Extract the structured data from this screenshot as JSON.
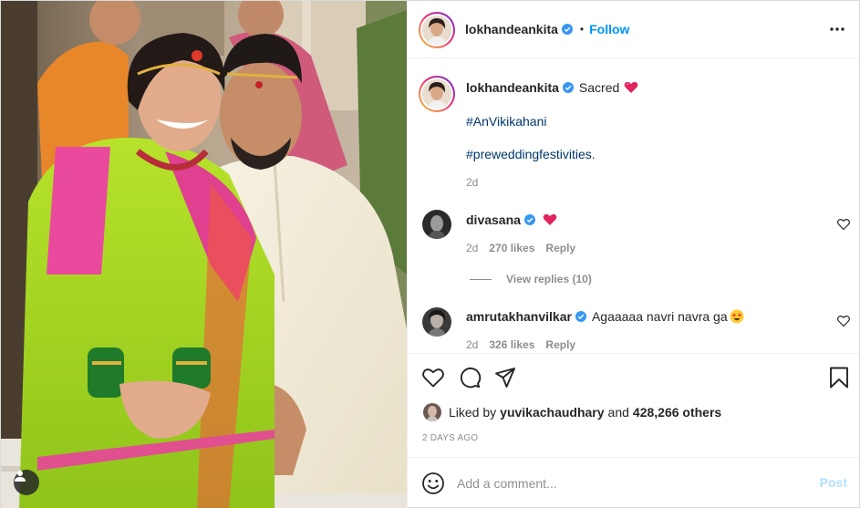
{
  "post": {
    "author": "lokhandeankita",
    "follow_label": "Follow",
    "dot": "•"
  },
  "caption": {
    "author": "lokhandeankita",
    "text": "Sacred",
    "hashtags": [
      "#AnVikikahani",
      "#preweddingfestivities."
    ],
    "time": "2d"
  },
  "comments": [
    {
      "author": "divasana",
      "text": "",
      "time": "2d",
      "likes": "270 likes",
      "reply_label": "Reply",
      "view_replies": "View replies (10)"
    },
    {
      "author": "amrutakhanvilkar",
      "text": "Agaaaaa navri navra ga",
      "time": "2d",
      "likes": "326 likes",
      "reply_label": "Reply"
    }
  ],
  "likes": {
    "prefix": "Liked by",
    "user": "yuvikachaudhary",
    "joiner": "and",
    "count": "428,266 others"
  },
  "date": "2 DAYS AGO",
  "add_comment": {
    "placeholder": "Add a comment...",
    "post_label": "Post"
  },
  "colors": {
    "accent": "#0095f6",
    "hashtag": "#00376b",
    "muted": "#8e8e8e",
    "post_disabled": "#b2dffc",
    "heart": "#ed4956"
  },
  "icons": [
    "verified-badge-icon",
    "more-options-icon",
    "heart-icon",
    "comment-icon",
    "share-icon",
    "save-icon",
    "emoji-icon",
    "user-tag-icon"
  ]
}
